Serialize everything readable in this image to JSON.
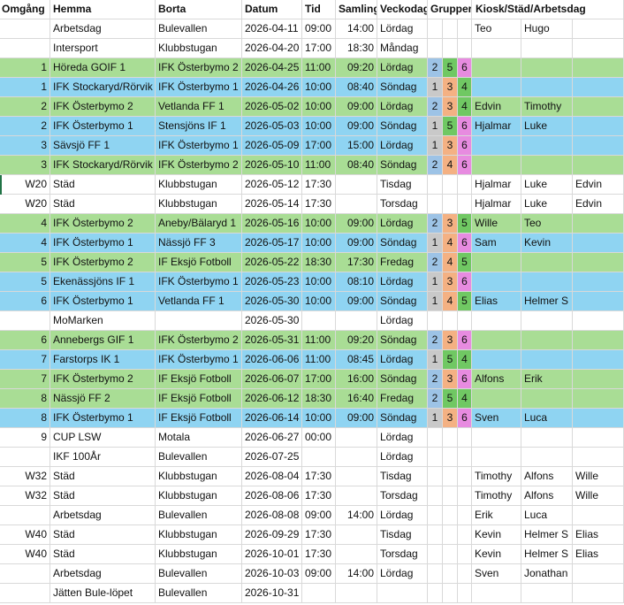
{
  "header": {
    "omgang": "Omgång",
    "hemma": "Hemma",
    "borta": "Borta",
    "datum": "Datum",
    "tid": "Tid",
    "samling": "Samling",
    "veckodag": "Veckodag",
    "grupper": "Grupper",
    "kiosk": "Kiosk/Städ/Arbetsdag"
  },
  "colors": {
    "green_row": "#a9dd95",
    "blue_row": "#8fd4f2",
    "group_blue": "#9dc3e6",
    "group_orange": "#f4b183",
    "group_green": "#70c863",
    "group_pink": "#e78be0",
    "group_grey": "#c9c9c9"
  },
  "rows": [
    {
      "fill": "white",
      "omg": "",
      "hemma": "Arbetsdag",
      "borta": "Bulevallen",
      "datum": "2026-04-11",
      "tid": "09:00",
      "samling": "14:00",
      "dag": "Lördag",
      "g1": "",
      "g2": "",
      "g3": "",
      "k1": "Teo",
      "k2": "Hugo",
      "k3": ""
    },
    {
      "fill": "white",
      "omg": "",
      "hemma": "Intersport",
      "borta": "Klubbstugan",
      "datum": "2026-04-20",
      "tid": "17:00",
      "samling": "18:30",
      "dag": "Måndag",
      "g1": "",
      "g2": "",
      "g3": "",
      "k1": "",
      "k2": "",
      "k3": ""
    },
    {
      "fill": "green",
      "omg": "1",
      "hemma": "Höreda GOIF 1",
      "borta": "IFK Österbymo 2",
      "datum": "2026-04-25",
      "tid": "11:00",
      "samling": "09:20",
      "dag": "Lördag",
      "g1": "2",
      "g2": "5",
      "g3": "6",
      "k1": "",
      "k2": "",
      "k3": ""
    },
    {
      "fill": "blue",
      "omg": "1",
      "hemma": "IFK Stockaryd/Rörvik",
      "borta": "IFK Österbymo 1",
      "datum": "2026-04-26",
      "tid": "10:00",
      "samling": "08:40",
      "dag": "Söndag",
      "g1": "1",
      "g2": "3",
      "g3": "4",
      "k1": "",
      "k2": "",
      "k3": ""
    },
    {
      "fill": "green",
      "omg": "2",
      "hemma": "IFK Österbymo 2",
      "borta": "Vetlanda FF 1",
      "datum": "2026-05-02",
      "tid": "10:00",
      "samling": "09:00",
      "dag": "Lördag",
      "g1": "2",
      "g2": "3",
      "g3": "4",
      "k1": "Edvin",
      "k2": "Timothy",
      "k3": ""
    },
    {
      "fill": "blue",
      "omg": "2",
      "hemma": "IFK Österbymo 1",
      "borta": "Stensjöns IF 1",
      "datum": "2026-05-03",
      "tid": "10:00",
      "samling": "09:00",
      "dag": "Söndag",
      "g1": "1",
      "g2": "5",
      "g3": "6",
      "k1": "Hjalmar",
      "k2": "Luke",
      "k3": ""
    },
    {
      "fill": "blue",
      "omg": "3",
      "hemma": "Sävsjö FF 1",
      "borta": "IFK Österbymo 1",
      "datum": "2026-05-09",
      "tid": "17:00",
      "samling": "15:00",
      "dag": "Lördag",
      "g1": "1",
      "g2": "3",
      "g3": "6",
      "k1": "",
      "k2": "",
      "k3": ""
    },
    {
      "fill": "green",
      "omg": "3",
      "hemma": "IFK Stockaryd/Rörvik",
      "borta": "IFK Österbymo 2",
      "datum": "2026-05-10",
      "tid": "11:00",
      "samling": "08:40",
      "dag": "Söndag",
      "g1": "2",
      "g2": "4",
      "g3": "6",
      "k1": "",
      "k2": "",
      "k3": ""
    },
    {
      "fill": "white",
      "omg": "W20",
      "hemma": "Städ",
      "borta": "Klubbstugan",
      "datum": "2026-05-12",
      "tid": "17:30",
      "samling": "",
      "dag": "Tisdag",
      "g1": "",
      "g2": "",
      "g3": "",
      "k1": "Hjalmar",
      "k2": "Luke",
      "k3": "Edvin"
    },
    {
      "fill": "white",
      "omg": "W20",
      "hemma": "Städ",
      "borta": "Klubbstugan",
      "datum": "2026-05-14",
      "tid": "17:30",
      "samling": "",
      "dag": "Torsdag",
      "g1": "",
      "g2": "",
      "g3": "",
      "k1": "Hjalmar",
      "k2": "Luke",
      "k3": "Edvin"
    },
    {
      "fill": "green",
      "omg": "4",
      "hemma": "IFK Österbymo 2",
      "borta": "Aneby/Bälaryd 1",
      "datum": "2026-05-16",
      "tid": "10:00",
      "samling": "09:00",
      "dag": "Lördag",
      "g1": "2",
      "g2": "3",
      "g3": "5",
      "k1": "Wille",
      "k2": "Teo",
      "k3": ""
    },
    {
      "fill": "blue",
      "omg": "4",
      "hemma": "IFK Österbymo 1",
      "borta": "Nässjö FF 3",
      "datum": "2026-05-17",
      "tid": "10:00",
      "samling": "09:00",
      "dag": "Söndag",
      "g1": "1",
      "g2": "4",
      "g3": "6",
      "k1": "Sam",
      "k2": "Kevin",
      "k3": ""
    },
    {
      "fill": "green",
      "omg": "5",
      "hemma": "IFK Österbymo 2",
      "borta": "IF Eksjö Fotboll",
      "datum": "2026-05-22",
      "tid": "18:30",
      "samling": "17:30",
      "dag": "Fredag",
      "g1": "2",
      "g2": "4",
      "g3": "5",
      "k1": "",
      "k2": "",
      "k3": ""
    },
    {
      "fill": "blue",
      "omg": "5",
      "hemma": "Ekenässjöns IF 1",
      "borta": "IFK Österbymo 1",
      "datum": "2026-05-23",
      "tid": "10:00",
      "samling": "08:10",
      "dag": "Lördag",
      "g1": "1",
      "g2": "3",
      "g3": "6",
      "k1": "",
      "k2": "",
      "k3": ""
    },
    {
      "fill": "blue",
      "omg": "6",
      "hemma": "IFK Österbymo 1",
      "borta": "Vetlanda FF 1",
      "datum": "2026-05-30",
      "tid": "10:00",
      "samling": "09:00",
      "dag": "Söndag",
      "g1": "1",
      "g2": "4",
      "g3": "5",
      "k1": "Elias",
      "k2": "Helmer S",
      "k3": ""
    },
    {
      "fill": "white",
      "omg": "",
      "hemma": "MoMarken",
      "borta": "",
      "datum": "2026-05-30",
      "tid": "",
      "samling": "",
      "dag": "Lördag",
      "g1": "",
      "g2": "",
      "g3": "",
      "k1": "",
      "k2": "",
      "k3": ""
    },
    {
      "fill": "green",
      "omg": "6",
      "hemma": "Annebergs GIF 1",
      "borta": "IFK Österbymo 2",
      "datum": "2026-05-31",
      "tid": "11:00",
      "samling": "09:20",
      "dag": "Söndag",
      "g1": "2",
      "g2": "3",
      "g3": "6",
      "k1": "",
      "k2": "",
      "k3": ""
    },
    {
      "fill": "blue",
      "omg": "7",
      "hemma": "Farstorps IK 1",
      "borta": "IFK Österbymo 1",
      "datum": "2026-06-06",
      "tid": "11:00",
      "samling": "08:45",
      "dag": "Lördag",
      "g1": "1",
      "g2": "5",
      "g3": "4",
      "k1": "",
      "k2": "",
      "k3": ""
    },
    {
      "fill": "green",
      "omg": "7",
      "hemma": "IFK Österbymo 2",
      "borta": "IF Eksjö Fotboll",
      "datum": "2026-06-07",
      "tid": "17:00",
      "samling": "16:00",
      "dag": "Söndag",
      "g1": "2",
      "g2": "3",
      "g3": "6",
      "k1": "Alfons",
      "k2": "Erik",
      "k3": ""
    },
    {
      "fill": "green",
      "omg": "8",
      "hemma": "Nässjö FF 2",
      "borta": "IF Eksjö Fotboll",
      "datum": "2026-06-12",
      "tid": "18:30",
      "samling": "16:40",
      "dag": "Fredag",
      "g1": "2",
      "g2": "5",
      "g3": "4",
      "k1": "",
      "k2": "",
      "k3": ""
    },
    {
      "fill": "blue",
      "omg": "8",
      "hemma": "IFK Österbymo 1",
      "borta": "IF Eksjö Fotboll",
      "datum": "2026-06-14",
      "tid": "10:00",
      "samling": "09:00",
      "dag": "Söndag",
      "g1": "1",
      "g2": "3",
      "g3": "6",
      "k1": "Sven",
      "k2": "Luca",
      "k3": ""
    },
    {
      "fill": "white",
      "omg": "9",
      "hemma": "CUP LSW",
      "borta": "Motala",
      "datum": "2026-06-27",
      "tid": "00:00",
      "samling": "",
      "dag": "Lördag",
      "g1": "",
      "g2": "",
      "g3": "",
      "k1": "",
      "k2": "",
      "k3": ""
    },
    {
      "fill": "white",
      "omg": "",
      "hemma": "IKF 100År",
      "borta": "Bulevallen",
      "datum": "2026-07-25",
      "tid": "",
      "samling": "",
      "dag": "Lördag",
      "g1": "",
      "g2": "",
      "g3": "",
      "k1": "",
      "k2": "",
      "k3": ""
    },
    {
      "fill": "white",
      "omg": "W32",
      "hemma": "Städ",
      "borta": "Klubbstugan",
      "datum": "2026-08-04",
      "tid": "17:30",
      "samling": "",
      "dag": "Tisdag",
      "g1": "",
      "g2": "",
      "g3": "",
      "k1": "Timothy",
      "k2": "Alfons",
      "k3": "Wille"
    },
    {
      "fill": "white",
      "omg": "W32",
      "hemma": "Städ",
      "borta": "Klubbstugan",
      "datum": "2026-08-06",
      "tid": "17:30",
      "samling": "",
      "dag": "Torsdag",
      "g1": "",
      "g2": "",
      "g3": "",
      "k1": "Timothy",
      "k2": "Alfons",
      "k3": "Wille"
    },
    {
      "fill": "white",
      "omg": "",
      "hemma": "Arbetsdag",
      "borta": "Bulevallen",
      "datum": "2026-08-08",
      "tid": "09:00",
      "samling": "14:00",
      "dag": "Lördag",
      "g1": "",
      "g2": "",
      "g3": "",
      "k1": "Erik",
      "k2": "Luca",
      "k3": ""
    },
    {
      "fill": "white",
      "omg": "W40",
      "hemma": "Städ",
      "borta": "Klubbstugan",
      "datum": "2026-09-29",
      "tid": "17:30",
      "samling": "",
      "dag": "Tisdag",
      "g1": "",
      "g2": "",
      "g3": "",
      "k1": "Kevin",
      "k2": "Helmer S",
      "k3": "Elias"
    },
    {
      "fill": "white",
      "omg": "W40",
      "hemma": "Städ",
      "borta": "Klubbstugan",
      "datum": "2026-10-01",
      "tid": "17:30",
      "samling": "",
      "dag": "Torsdag",
      "g1": "",
      "g2": "",
      "g3": "",
      "k1": "Kevin",
      "k2": "Helmer S",
      "k3": "Elias"
    },
    {
      "fill": "white",
      "omg": "",
      "hemma": "Arbetsdag",
      "borta": "Bulevallen",
      "datum": "2026-10-03",
      "tid": "09:00",
      "samling": "14:00",
      "dag": "Lördag",
      "g1": "",
      "g2": "",
      "g3": "",
      "k1": "Sven",
      "k2": "Jonathan",
      "k3": ""
    },
    {
      "fill": "white",
      "omg": "",
      "hemma": "Jätten Bule-löpet",
      "borta": "Bulevallen",
      "datum": "2026-10-31",
      "tid": "",
      "samling": "",
      "dag": "",
      "g1": "",
      "g2": "",
      "g3": "",
      "k1": "",
      "k2": "",
      "k3": ""
    }
  ]
}
